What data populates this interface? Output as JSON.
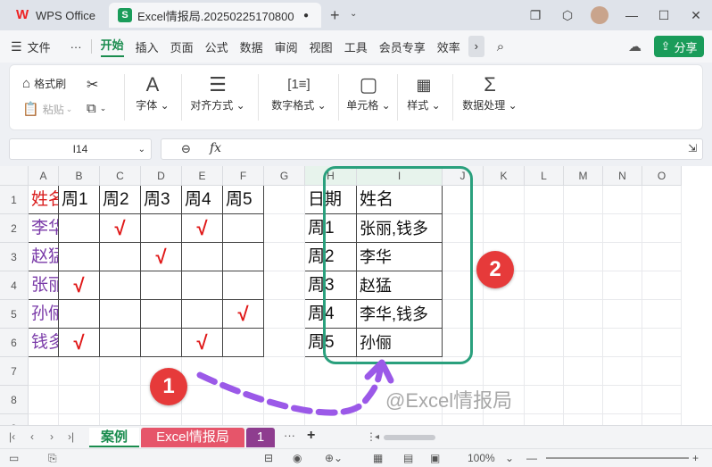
{
  "titlebar": {
    "tabs": [
      {
        "label": "WPS Office"
      },
      {
        "label": "Excel情报局.20250225170800"
      }
    ],
    "new_tab": "+"
  },
  "menu": {
    "file": "文件",
    "more": "···",
    "items": [
      "开始",
      "插入",
      "页面",
      "公式",
      "数据",
      "审阅",
      "视图",
      "工具",
      "会员专享",
      "效率"
    ],
    "active": "开始",
    "share": "分享"
  },
  "ribbon": {
    "format_painter": "格式刷",
    "paste": "粘贴",
    "groups": [
      "字体",
      "对齐方式",
      "数字格式",
      "单元格",
      "样式",
      "数据处理"
    ]
  },
  "formula_bar": {
    "name_box": "I14",
    "fx": "fx",
    "value": ""
  },
  "grid": {
    "columns": [
      "A",
      "B",
      "C",
      "D",
      "E",
      "F",
      "G",
      "H",
      "I",
      "J",
      "K",
      "L",
      "M",
      "N",
      "O"
    ],
    "rows": [
      "1",
      "2",
      "3",
      "4",
      "5",
      "6",
      "7",
      "8",
      "9"
    ],
    "left_table": {
      "header": [
        "姓名",
        "周1",
        "周2",
        "周3",
        "周4",
        "周5"
      ],
      "rows": [
        {
          "name": "李华",
          "marks": [
            "",
            "√",
            "",
            "√",
            ""
          ]
        },
        {
          "name": "赵猛",
          "marks": [
            "",
            "",
            "√",
            "",
            ""
          ]
        },
        {
          "name": "张丽",
          "marks": [
            "√",
            "",
            "",
            "",
            ""
          ]
        },
        {
          "name": "孙俪",
          "marks": [
            "",
            "",
            "",
            "",
            "√"
          ]
        },
        {
          "name": "钱多",
          "marks": [
            "√",
            "",
            "",
            "√",
            ""
          ]
        }
      ]
    },
    "right_table": {
      "header": [
        "日期",
        "姓名"
      ],
      "rows": [
        [
          "周1",
          "张丽,钱多"
        ],
        [
          "周2",
          "李华"
        ],
        [
          "周3",
          "赵猛"
        ],
        [
          "周4",
          "李华,钱多"
        ],
        [
          "周5",
          "孙俪"
        ]
      ]
    }
  },
  "annotations": {
    "badge1": "1",
    "badge2": "2",
    "watermark": "@Excel情报局",
    "frame_color": "#2aa07d",
    "arrow_color": "#9b59e8"
  },
  "sheets": {
    "tabs": [
      "案例",
      "Excel情报局",
      "1"
    ],
    "more": "···",
    "add": "+"
  },
  "status": {
    "zoom": "100%"
  },
  "colors": {
    "accent": "#1a8c4e",
    "name_red": "#d91e1e",
    "name_purple": "#7a3aa8",
    "check_red": "#e01818"
  }
}
